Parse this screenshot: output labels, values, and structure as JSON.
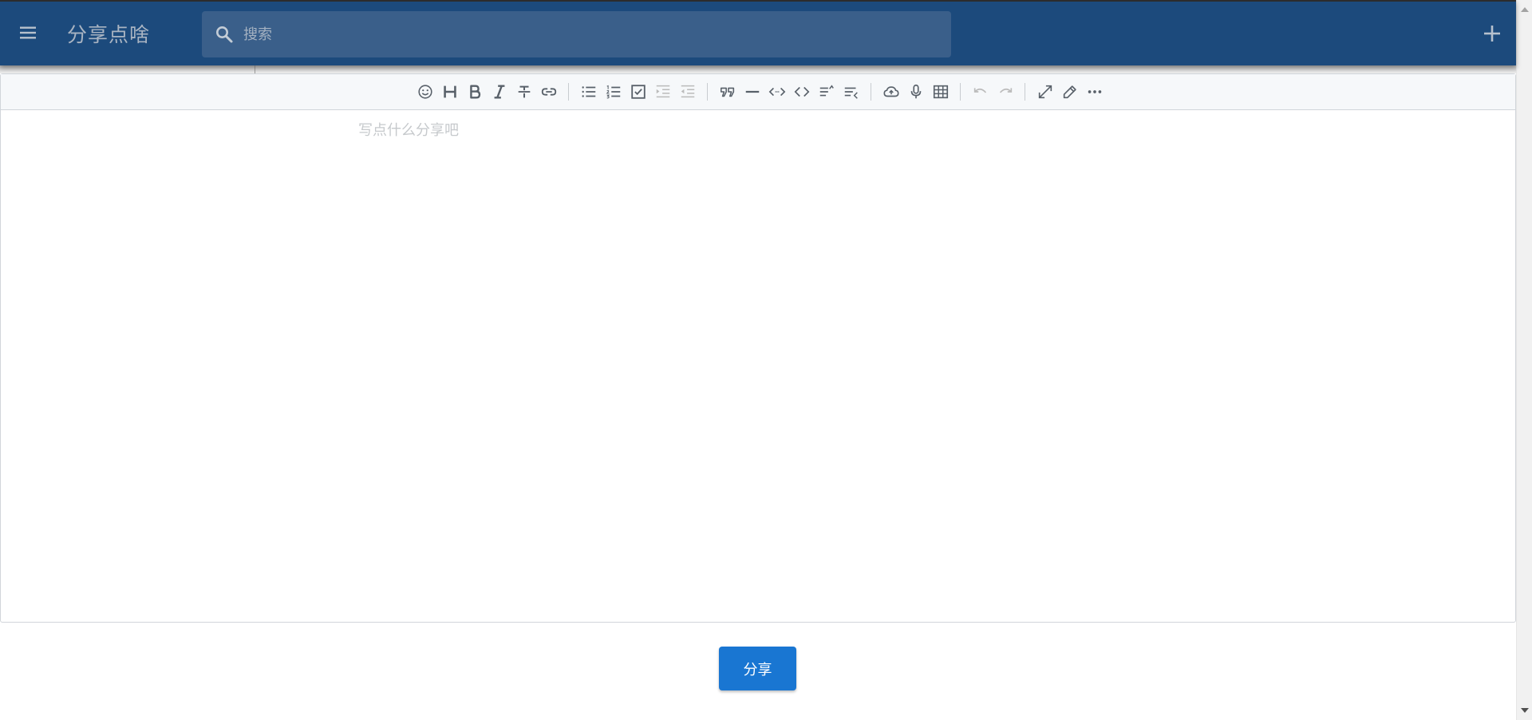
{
  "header": {
    "menu_icon": "menu-icon",
    "title": "分享点啥",
    "search": {
      "icon": "search-icon",
      "placeholder": "搜索",
      "value": ""
    },
    "add_icon": "plus-icon"
  },
  "editor": {
    "toolbar": [
      [
        "emoji-icon",
        "heading-icon",
        "bold-icon",
        "italic-icon",
        "strike-icon",
        "link-icon"
      ],
      [
        "bullet-list-icon",
        "ordered-list-icon",
        "checklist-icon",
        "outdent-icon",
        "indent-icon"
      ],
      [
        "quote-icon",
        "horizontal-line-icon",
        "code-block-icon",
        "inline-code-icon",
        "insert-before-icon",
        "insert-after-icon"
      ],
      [
        "upload-icon",
        "record-icon",
        "table-icon"
      ],
      [
        "undo-icon",
        "redo-icon"
      ],
      [
        "fullscreen-icon",
        "edit-mode-icon",
        "more-icon"
      ]
    ],
    "placeholder": "写点什么分享吧",
    "value": ""
  },
  "actions": {
    "share_label": "分享"
  },
  "colors": {
    "appbar": "#1c4a7c",
    "search_bg": "#3a5f8a",
    "primary_button": "#1976d2",
    "toolbar_bg": "#f6f8fa",
    "icon": "#586069",
    "icon_disabled": "#bbbbbb"
  }
}
